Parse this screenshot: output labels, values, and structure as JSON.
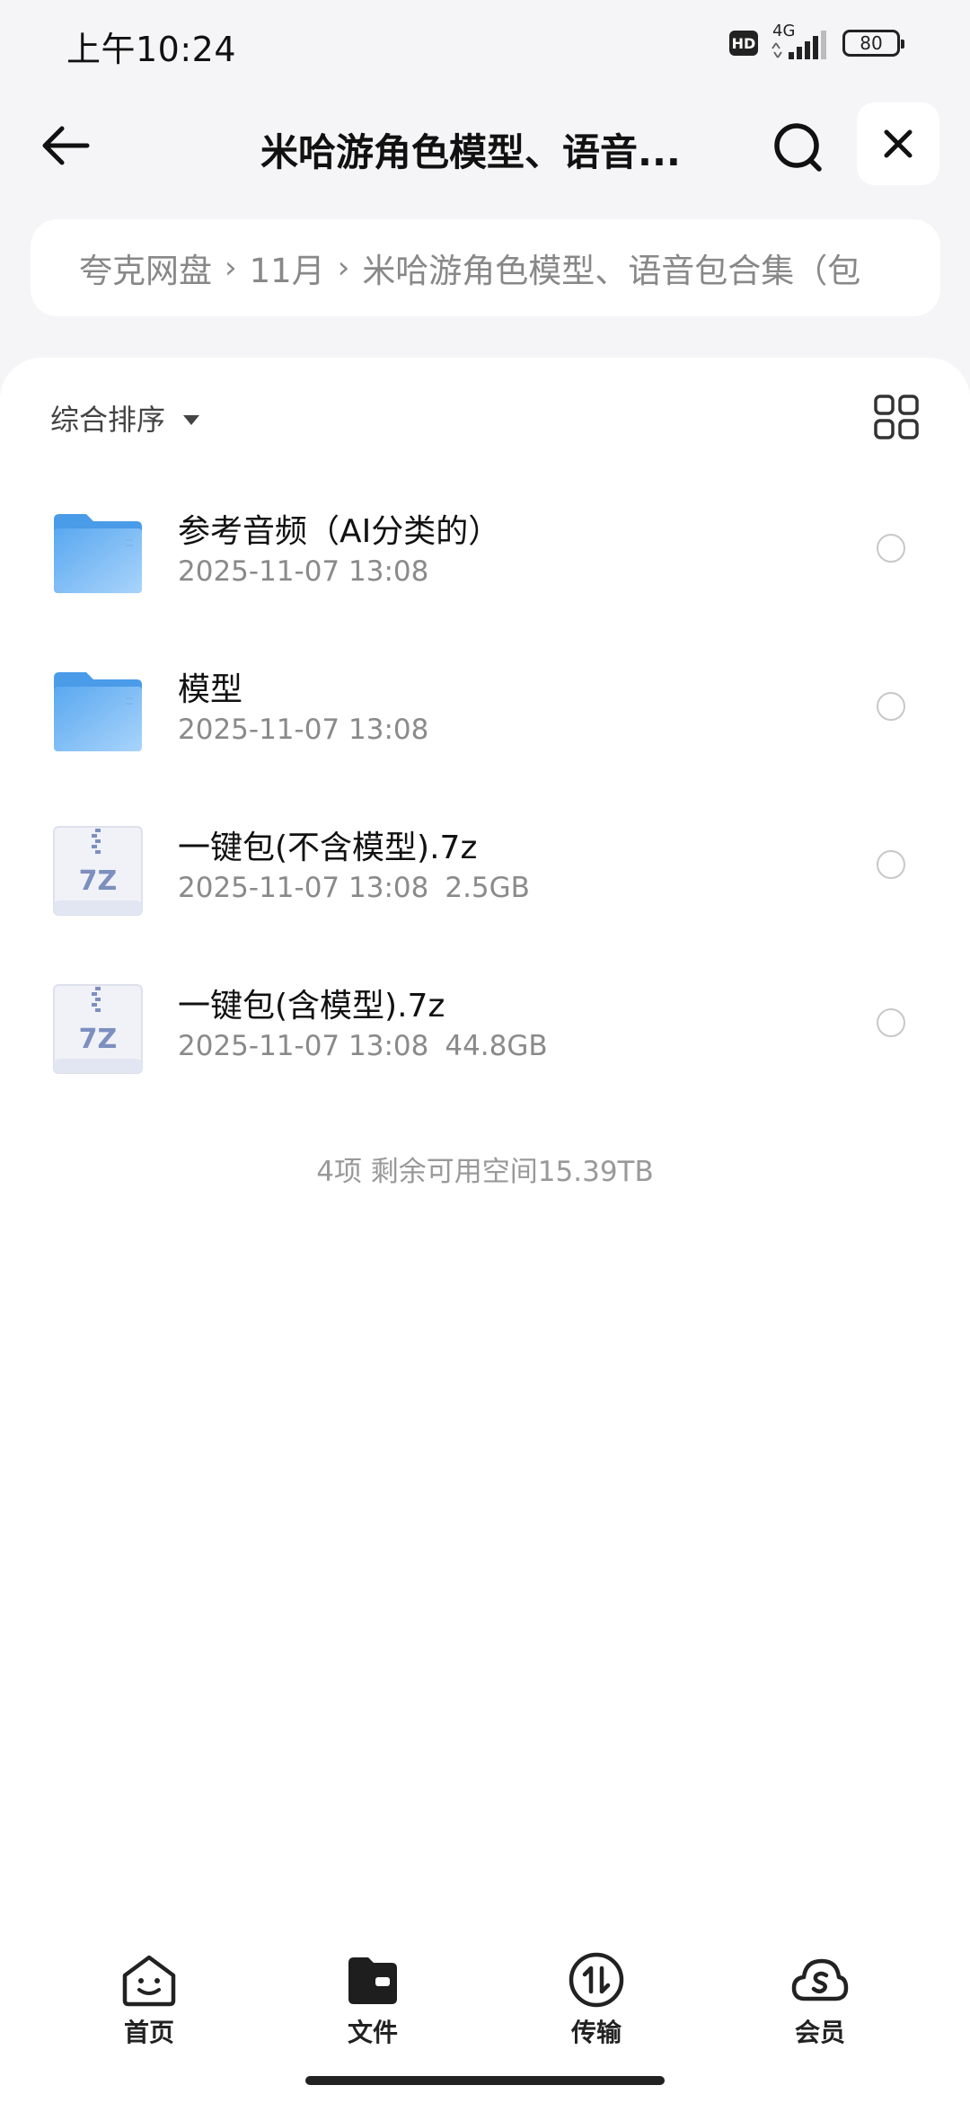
{
  "status_bar": {
    "time": "上午10:24",
    "hd": "HD",
    "network": "4G",
    "battery": "80"
  },
  "header": {
    "title": "米哈游角色模型、语音...",
    "icons": {
      "back": "back-arrow-icon",
      "search": "search-icon",
      "close": "close-icon"
    }
  },
  "breadcrumb": {
    "items": [
      "夸克网盘",
      "11月",
      "米哈游角色模型、语音包合集（包"
    ],
    "separator": "›"
  },
  "toolbar": {
    "sort_label": "综合排序",
    "view_icon": "grid-view-icon"
  },
  "files": [
    {
      "name": "参考音频（AI分类的）",
      "date": "2025-11-07 13:08",
      "size": "",
      "type": "folder"
    },
    {
      "name": "模型",
      "date": "2025-11-07 13:08",
      "size": "",
      "type": "folder"
    },
    {
      "name": "一键包(不含模型).7z",
      "date": "2025-11-07 13:08",
      "size": "2.5GB",
      "type": "7z"
    },
    {
      "name": "一键包(含模型).7z",
      "date": "2025-11-07 13:08",
      "size": "44.8GB",
      "type": "7z"
    }
  ],
  "archive_icon_label": "7Z",
  "summary": "4项 剩余可用空间15.39TB",
  "bottom_nav": [
    {
      "label": "首页",
      "icon": "home-face-icon"
    },
    {
      "label": "文件",
      "icon": "folder-icon"
    },
    {
      "label": "传输",
      "icon": "transfer-icon"
    },
    {
      "label": "会员",
      "icon": "cloud-member-icon"
    }
  ],
  "colors": {
    "background": "#f5f5f7",
    "folder_blue": "#5aa8f0",
    "text_primary": "#111111",
    "text_secondary": "#8a8a8a"
  }
}
